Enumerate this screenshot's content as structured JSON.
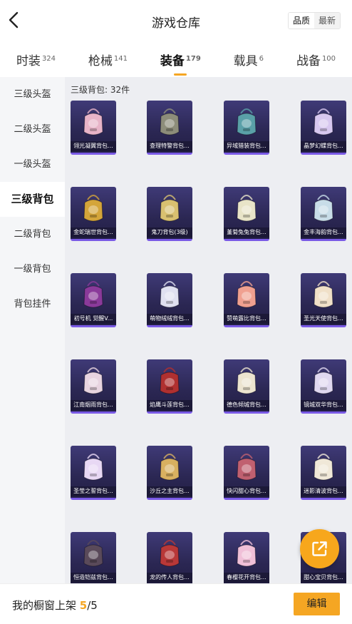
{
  "header": {
    "title": "游戏仓库",
    "sort": {
      "quality": "品质",
      "latest": "最新"
    }
  },
  "tabs": [
    {
      "label": "时装",
      "count": "324"
    },
    {
      "label": "枪械",
      "count": "141"
    },
    {
      "label": "装备",
      "count": "179"
    },
    {
      "label": "载具",
      "count": "6"
    },
    {
      "label": "战备",
      "count": "100"
    }
  ],
  "sidebar": {
    "items": [
      {
        "label": "三级头盔"
      },
      {
        "label": "二级头盔"
      },
      {
        "label": "一级头盔"
      },
      {
        "label": "三级背包"
      },
      {
        "label": "二级背包"
      },
      {
        "label": "一级背包"
      },
      {
        "label": "背包挂件"
      }
    ]
  },
  "content": {
    "count_label": "三级背包: 32件",
    "items": [
      {
        "name": "翎光凝翼背包...",
        "color": "#e8b4c8"
      },
      {
        "name": "查理特警背包...",
        "color": "#8d8d7a"
      },
      {
        "name": "异域猎装背包...",
        "color": "#5aa0a8"
      },
      {
        "name": "晶梦幻蝶背包...",
        "color": "#d8c8f0"
      },
      {
        "name": "金蛇瑞世背包...",
        "color": "#d4a53a"
      },
      {
        "name": "鬼刀背包(3级)",
        "color": "#d8c070"
      },
      {
        "name": "堇菊兔兔背包...",
        "color": "#e8e4c8"
      },
      {
        "name": "金丰海韵背包...",
        "color": "#c8dde8"
      },
      {
        "name": "初号机 觉醒V...",
        "color": "#8a3a9a"
      },
      {
        "name": "萌物绒绒背包...",
        "color": "#e0e0f0"
      },
      {
        "name": "赞萌露比背包...",
        "color": "#f0a090"
      },
      {
        "name": "圣光天使背包...",
        "color": "#f0e0c8"
      },
      {
        "name": "江南烟雨背包...",
        "color": "#e8d4e0"
      },
      {
        "name": "焰鹰斗莲背包...",
        "color": "#b03030"
      },
      {
        "name": "德色倾城背包...",
        "color": "#ece4d0"
      },
      {
        "name": "镜城双华背包...",
        "color": "#e0d8f0"
      },
      {
        "name": "圣莹之誓背包...",
        "color": "#e8d8f4"
      },
      {
        "name": "沙丘之主背包...",
        "color": "#d8b060"
      },
      {
        "name": "快闪甜心背包...",
        "color": "#c06070"
      },
      {
        "name": "迷影清波背包...",
        "color": "#f0e8d8"
      },
      {
        "name": "恒造铠兹背包...",
        "color": "#5a4a5a"
      },
      {
        "name": "龙的传人背包...",
        "color": "#b83838"
      },
      {
        "name": "春樱花开背包...",
        "color": "#f0c0d8"
      },
      {
        "name": "甜心宝贝背包...",
        "color": "#e8b0c0"
      }
    ]
  },
  "footer": {
    "shelf_label": "我的橱窗上架",
    "shelf_current": "5",
    "shelf_sep": "/",
    "shelf_total": "5",
    "edit_label": "编辑"
  },
  "colors": {
    "accent": "#f5a623",
    "card_bg": "#2b2753",
    "card_border": "#7a5ae6"
  }
}
